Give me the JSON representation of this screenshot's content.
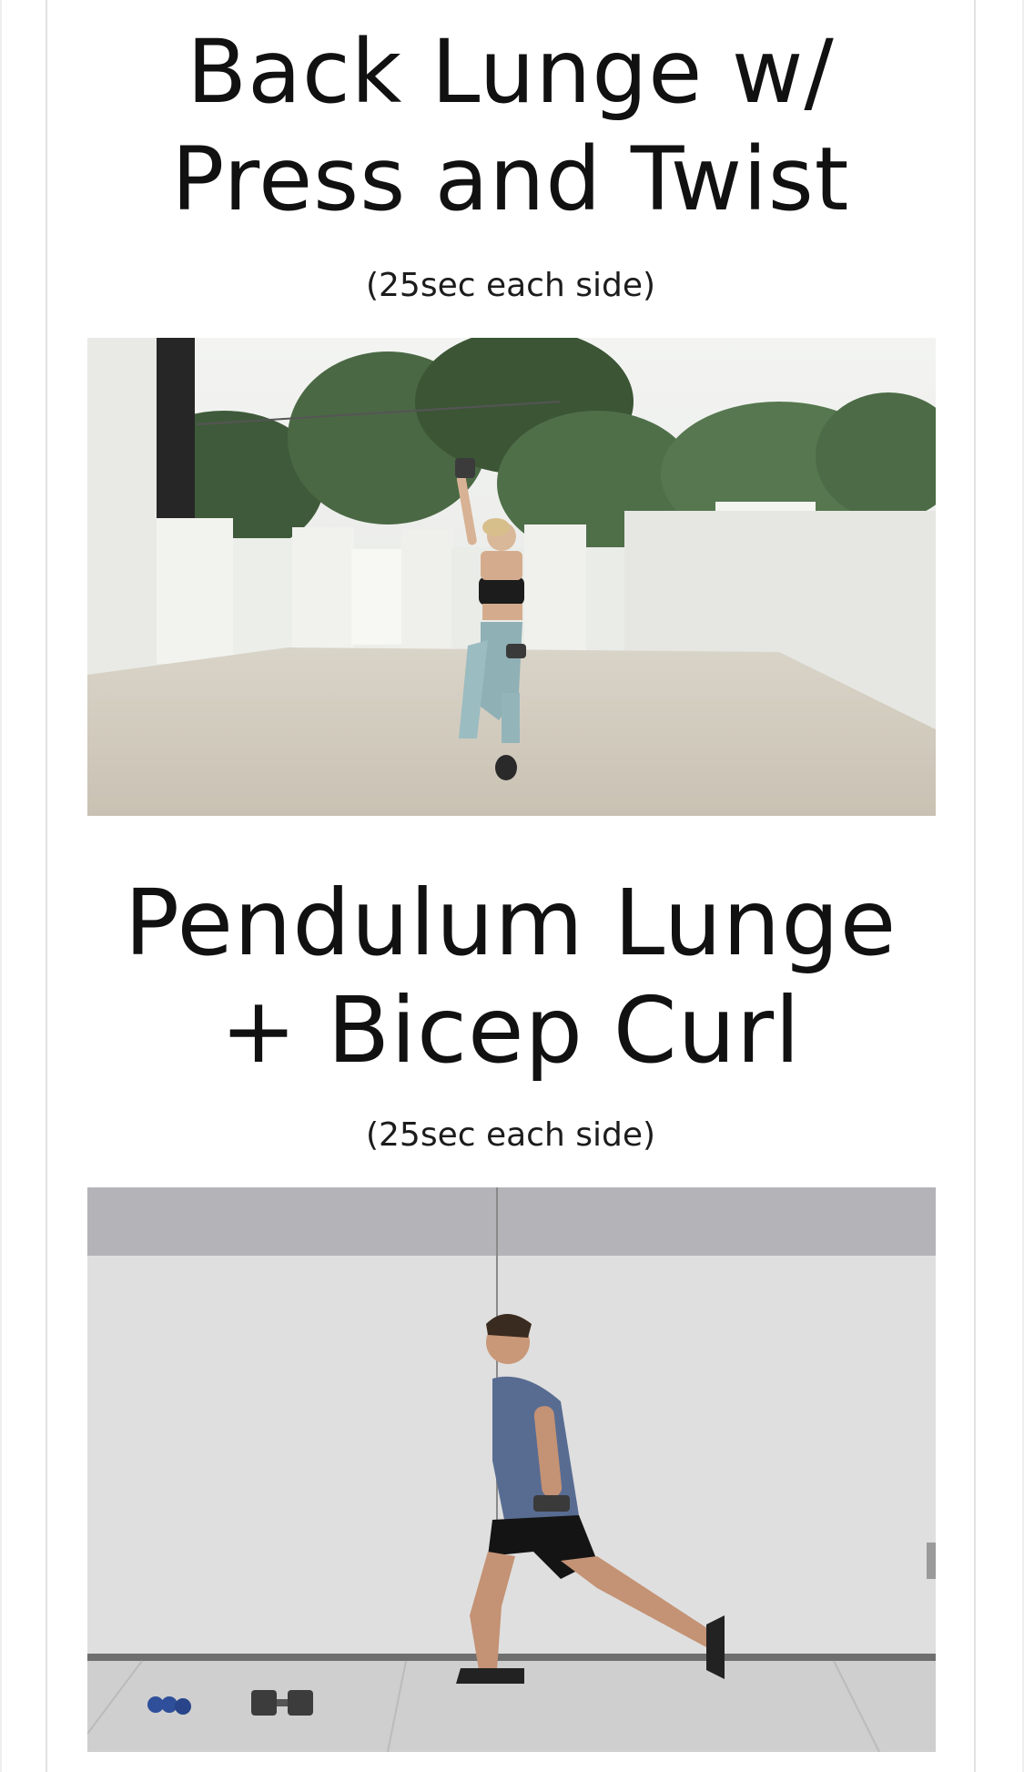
{
  "exercises": [
    {
      "title_line1": "Back Lunge w/",
      "title_line2": "Press and Twist",
      "duration": "(25sec each side)",
      "photo_icon": "woman-lunge-press-photo"
    },
    {
      "title_line1": "Pendulum Lunge",
      "title_line2": "+ Bicep Curl",
      "duration": "(25sec each side)",
      "photo_icon": "man-lunge-curl-photo"
    }
  ],
  "colors": {
    "text": "#111111",
    "background": "#ffffff",
    "border": "#e2e2e2"
  }
}
